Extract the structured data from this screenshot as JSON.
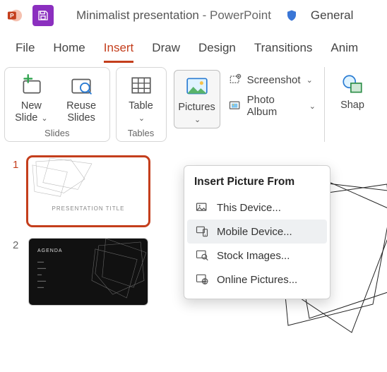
{
  "title": {
    "doc": "Minimalist presentation",
    "sep": " - ",
    "app": "PowerPoint",
    "sensitivity": "General"
  },
  "tabs": {
    "file": "File",
    "home": "Home",
    "insert": "Insert",
    "draw": "Draw",
    "design": "Design",
    "transitions": "Transitions",
    "anim": "Anim"
  },
  "ribbon": {
    "new_slide": "New Slide",
    "reuse": "Reuse Slides",
    "slides_group": "Slides",
    "table": "Table",
    "tables_group": "Tables",
    "pictures": "Pictures",
    "screenshot": "Screenshot",
    "photo_album": "Photo Album",
    "shapes": "Shap"
  },
  "popup": {
    "title": "Insert Picture From",
    "this_device": "This Device...",
    "mobile": "Mobile Device...",
    "stock": "Stock Images...",
    "online": "Online Pictures..."
  },
  "thumbs": {
    "n1": "1",
    "n2": "2",
    "slide1_title": "PRESENTATION TITLE",
    "slide2_title": "AGENDA"
  }
}
